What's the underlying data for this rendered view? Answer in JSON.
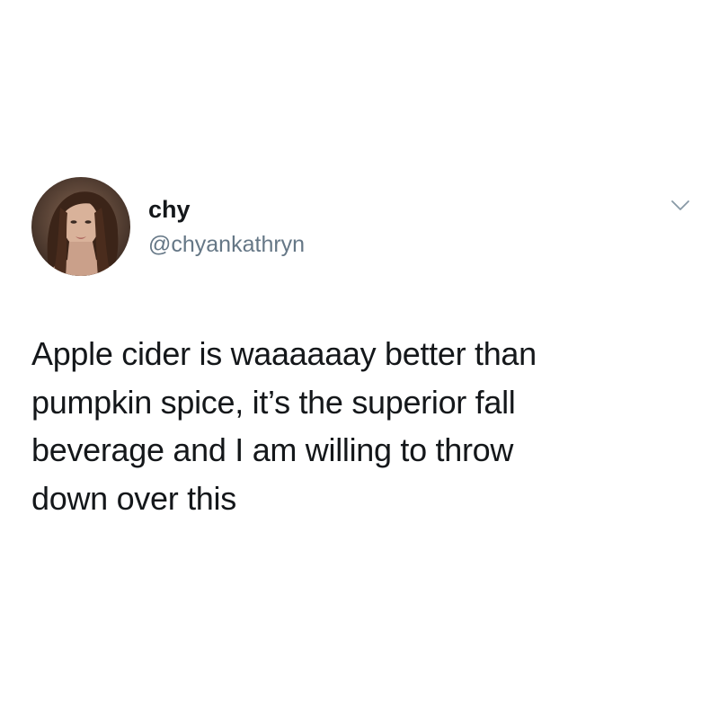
{
  "tweet": {
    "author": {
      "display_name": "chy",
      "handle": "@chyankathryn",
      "avatar_icon": "profile-photo-avatar"
    },
    "menu_icon": "chevron-down-icon",
    "text": "Apple cider is waaaaaay better than\npumpkin spice, it’s the superior fall\nbeverage and I am willing to throw\ndown over this"
  },
  "colors": {
    "background": "#ffffff",
    "text_primary": "#14171a",
    "text_secondary": "#657786",
    "caret": "#8899a6"
  }
}
